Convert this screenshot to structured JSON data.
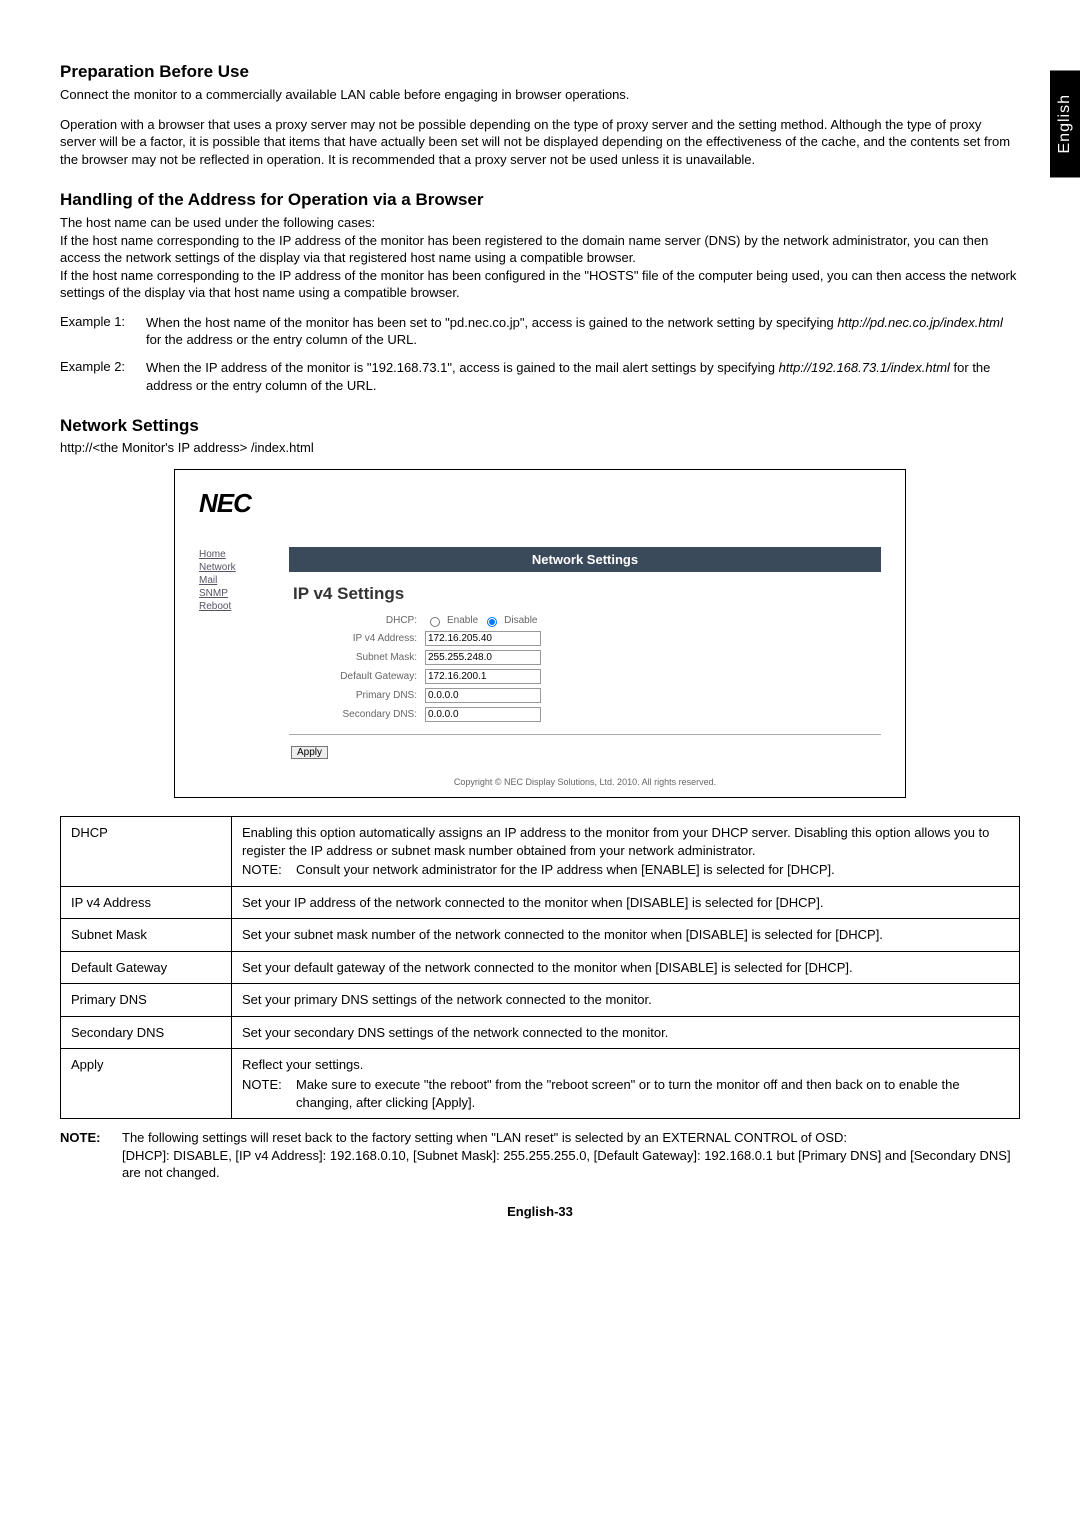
{
  "lang_tab": "English",
  "sec1": {
    "heading": "Preparation Before Use",
    "p1": "Connect the monitor to a commercially available LAN cable before engaging in browser operations.",
    "p2": "Operation with a browser that uses a proxy server may not be possible depending on the type of proxy server and the setting method. Although the type of proxy server will be a factor, it is possible that items that have actually been set will not be displayed depending on the effectiveness of the cache, and the contents set from the browser may not be reflected in operation. It is recommended that a proxy server not be used unless it is unavailable."
  },
  "sec2": {
    "heading": "Handling of the Address for Operation via a Browser",
    "p1": "The host name can be used under the following cases:",
    "p2": "If the host name corresponding to the IP address of the monitor has been registered to the domain name server (DNS) by the network administrator, you can then access the network settings of the display via that registered host name using a compatible browser.",
    "p3": "If the host name corresponding to the IP address of the monitor has been configured in the \"HOSTS\" file of the computer being used, you can then access the network settings of the display via that host name using a compatible browser.",
    "ex1_label": "Example 1:",
    "ex1_text_a": "When the host name of the monitor has been set to \"pd.nec.co.jp\", access is gained to the network setting by specifying ",
    "ex1_url": "http://pd.nec.co.jp/index.html",
    "ex1_text_b": " for the address or the entry column of the URL.",
    "ex2_label": "Example 2:",
    "ex2_text_a": "When the IP address of the monitor is \"192.168.73.1\", access is gained to the mail alert settings by specifying ",
    "ex2_url": "http://192.168.73.1/index.html",
    "ex2_text_b": " for the address or the entry column of the URL."
  },
  "sec3": {
    "heading": "Network Settings",
    "url": "http://<the Monitor's IP address> /index.html"
  },
  "screenshot": {
    "logo": "NEC",
    "nav": [
      "Home",
      "Network",
      "Mail",
      "SNMP",
      "Reboot"
    ],
    "banner": "Network Settings",
    "subheading": "IP v4 Settings",
    "rows": {
      "dhcp_label": "DHCP:",
      "dhcp_enable": "Enable",
      "dhcp_disable": "Disable",
      "ip_label": "IP v4 Address:",
      "ip_value": "172.16.205.40",
      "subnet_label": "Subnet Mask:",
      "subnet_value": "255.255.248.0",
      "gateway_label": "Default Gateway:",
      "gateway_value": "172.16.200.1",
      "pdns_label": "Primary DNS:",
      "pdns_value": "0.0.0.0",
      "sdns_label": "Secondary DNS:",
      "sdns_value": "0.0.0.0"
    },
    "apply": "Apply",
    "copyright": "Copyright © NEC Display Solutions, Ltd. 2010. All rights reserved."
  },
  "table": {
    "r1_label": "DHCP",
    "r1_text_a": "Enabling this option automatically assigns an IP address to the monitor from your DHCP server. Disabling this option allows you to register the IP address or subnet mask number obtained from your network administrator.",
    "r1_note_label": "NOTE:",
    "r1_note_text": "Consult your network administrator for the IP address when [ENABLE] is selected for [DHCP].",
    "r2_label": "IP v4 Address",
    "r2_text": "Set your IP address of the network connected to the monitor when [DISABLE] is selected for [DHCP].",
    "r3_label": "Subnet Mask",
    "r3_text": "Set your subnet mask number of the network connected to the monitor when [DISABLE] is selected for [DHCP].",
    "r4_label": "Default Gateway",
    "r4_text": "Set your default gateway of the network connected to the monitor when [DISABLE] is selected for [DHCP].",
    "r5_label": "Primary DNS",
    "r5_text": "Set your primary DNS settings of the network connected to the monitor.",
    "r6_label": "Secondary DNS",
    "r6_text": "Set your secondary DNS settings of the network connected to the monitor.",
    "r7_label": "Apply",
    "r7_text_a": "Reflect your settings.",
    "r7_note_label": "NOTE:",
    "r7_note_text": "Make sure to execute \"the reboot\" from the \"reboot screen\" or to turn the monitor off and then back on to enable the changing, after clicking [Apply]."
  },
  "bottom_note": {
    "label": "NOTE:",
    "line1": "The following settings will reset back to the factory setting when \"LAN reset\" is selected by an EXTERNAL CONTROL of OSD:",
    "line2": "[DHCP]: DISABLE, [IP v4 Address]: 192.168.0.10, [Subnet Mask]: 255.255.255.0, [Default Gateway]: 192.168.0.1 but [Primary DNS] and [Secondary DNS] are not changed."
  },
  "footer": "English-33"
}
